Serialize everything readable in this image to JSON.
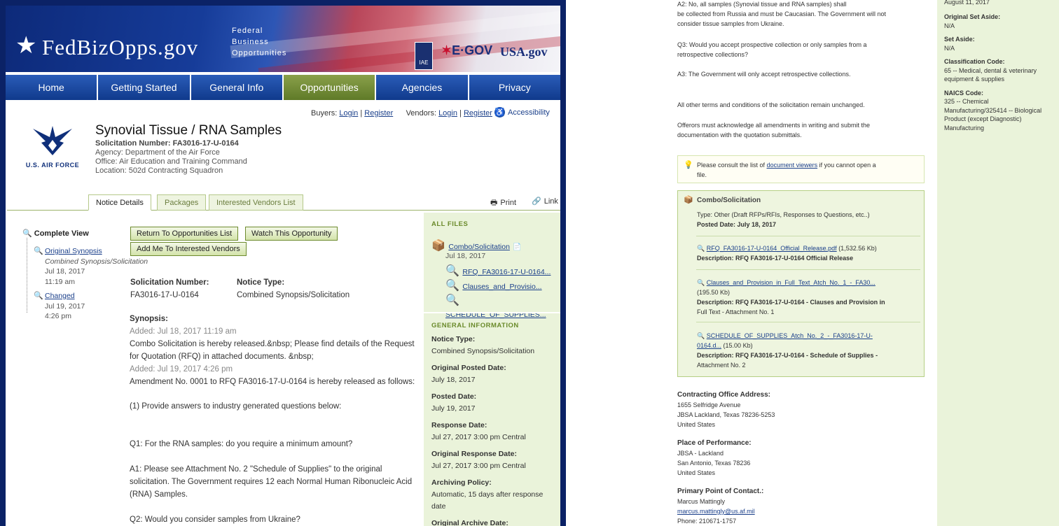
{
  "site": {
    "logo_star": "★",
    "logo_name": "FedBizOpps.gov",
    "logo_sub": [
      "Federal",
      "Business",
      "Opportunities"
    ],
    "iae": "IAE",
    "egov": "E·GOV",
    "usagov": "USA.gov"
  },
  "nav": [
    "Home",
    "Getting Started",
    "General Info",
    "Opportunities",
    "Agencies",
    "Privacy"
  ],
  "auth": {
    "buyers": "Buyers:",
    "vendors": "Vendors:",
    "login": "Login",
    "register": "Register",
    "sep": "|",
    "accessibility": "Accessibility"
  },
  "agency_logo": {
    "text": "U.S. AIR FORCE"
  },
  "notice": {
    "title": "Synovial Tissue / RNA Samples",
    "solicitation_label": "Solicitation Number:",
    "solicitation": "FA3016-17-U-0164",
    "agency": "Agency: Department of the Air Force",
    "office": "Office: Air Education and Training Command",
    "location": "Location: 502d Contracting Squadron"
  },
  "tabs": [
    "Notice Details",
    "Packages",
    "Interested Vendors List"
  ],
  "tools": {
    "print": "Print",
    "link": "Link"
  },
  "complete_view": "Complete View",
  "history": [
    {
      "link": "Original Synopsis",
      "type": "Combined Synopsis/Solicitation",
      "date": "Jul 18, 2017",
      "time": "11:19 am"
    },
    {
      "link": "Changed",
      "date": "Jul 19, 2017",
      "time": "4:26 pm"
    }
  ],
  "buttons": {
    "return": "Return To Opportunities List",
    "watch": "Watch This Opportunity",
    "add": "Add Me To Interested Vendors"
  },
  "fields": {
    "sol_label": "Solicitation Number:",
    "sol_value": "FA3016-17-U-0164",
    "type_label": "Notice Type:",
    "type_value": "Combined Synopsis/Solicitation"
  },
  "synopsis": {
    "label": "Synopsis:",
    "added1": "Added: Jul 18, 2017 11:19 am",
    "p1": "Combo Solicitation is hereby released.&nbsp; Please find details of the Request for Quotation (RFQ) in attached documents. &nbsp;",
    "added2": "Added: Jul 19, 2017 4:26 pm",
    "p2": "Amendment No. 0001 to RFQ FA3016-17-U-0164 is hereby released as follows:",
    "p3": "(1) Provide answers to industry generated questions below:",
    "q1": "Q1: For the RNA samples: do you require a minimum amount?",
    "a1": "A1: Please see Attachment No. 2 \"Schedule of Supplies\" to the original solicitation.  The Government requires 12 each Normal Human Ribonucleic Acid (RNA) Samples.",
    "q2": "Q2: Would you consider samples from Ukraine?"
  },
  "sidebar": {
    "all_files": "ALL FILES",
    "combo_link": "Combo/Solicitation",
    "combo_date": "Jul 18, 2017",
    "files": [
      "RFQ_FA3016-17-U-0164...",
      "Clauses_and_Provisio...",
      "SCHEDULE_OF_SUPPLIES..."
    ],
    "general_info": "GENERAL INFORMATION",
    "info": [
      {
        "k": "Notice Type:",
        "v": "Combined Synopsis/Solicitation"
      },
      {
        "k": "Original Posted Date:",
        "v": "July 18, 2017"
      },
      {
        "k": "Posted Date:",
        "v": "July 19, 2017"
      },
      {
        "k": "Response Date:",
        "v": "Jul 27, 2017 3:00 pm Central"
      },
      {
        "k": "Original Response Date:",
        "v": "Jul 27, 2017 3:00 pm Central"
      },
      {
        "k": "Archiving Policy:",
        "v": "Automatic, 15 days after response date"
      },
      {
        "k": "Original Archive Date:",
        "v": ""
      }
    ]
  },
  "right": {
    "a2a": "A2: No, all samples (Synovial tissue and RNA samples) shall",
    "a2b": "be collected from Russia and must be Caucasian.  The Government will not",
    "a2c": "consider tissue samples from Ukraine.",
    "q3a": "Q3: Would you accept prospective collection or only samples from a",
    "q3b": "retrospective collections?",
    "a3": "A3: The Government will only accept retrospective collections.",
    "terms": "All other terms and conditions of the solicitation remain unchanged.",
    "ack1": "Offerors must acknowledge all amendments in writing and submit the",
    "ack2": "documentation with the quotation submittals.",
    "note_pre": "Please consult the list of ",
    "note_link": "document viewers",
    "note_post": " if you cannot open a",
    "note_post2": "file.",
    "combo": {
      "title": "Combo/Solicitation",
      "type": "Type: Other (Draft RFPs/RFIs, Responses to Questions, etc..)",
      "posted": "Posted Date: July 18, 2017",
      "files": [
        {
          "link": "RFQ_FA3016-17-U-0164_Official_Release.pdf",
          "size": "(1,532.56 Kb)",
          "desc": "Description: RFQ FA3016-17-U-0164 Official Release"
        },
        {
          "link": "Clauses_and_Provision_in_Full_Text_Atch_No._1_-_FA30...",
          "size": "(195.50 Kb)",
          "desc": "Description: RFQ FA3016-17-U-0164 - Clauses and Provision in",
          "desc2": "Full Text - Attachment No. 1"
        },
        {
          "link": "SCHEDULE_OF_SUPPLIES_Atch_No._2_-_FA3016-17-U-",
          "link2": "0164.d...",
          "size": "(15.00 Kb)",
          "desc": "Description: RFQ FA3016-17-U-0164 - Schedule of Supplies -",
          "desc2": "Attachment No. 2"
        }
      ]
    },
    "office_label": "Contracting Office Address:",
    "office": [
      "1655 Selfridge Avenue",
      "JBSA Lackland, Texas 78236-5253",
      "United States"
    ],
    "pop_label": "Place of Performance:",
    "pop": [
      "JBSA - Lackland",
      "San Antonio, Texas 78236",
      "United States"
    ],
    "poc_label": "Primary Point of Contact.:",
    "poc_name": "Marcus Mattingly",
    "poc_email": "marcus.mattingly@us.af.mil",
    "poc_phone": "Phone: 210671-1757"
  },
  "rside": {
    "top_date": "August 11, 2017",
    "items": [
      {
        "k": "Original Set Aside:",
        "v": "N/A"
      },
      {
        "k": "Set Aside:",
        "v": "N/A"
      },
      {
        "k": "Classification Code:",
        "v": "65 -- Medical, dental & veterinary equipment & supplies"
      },
      {
        "k": "NAICS Code:",
        "v": "325 -- Chemical Manufacturing/325414 -- Biological Product (except Diagnostic) Manufacturing"
      }
    ]
  }
}
